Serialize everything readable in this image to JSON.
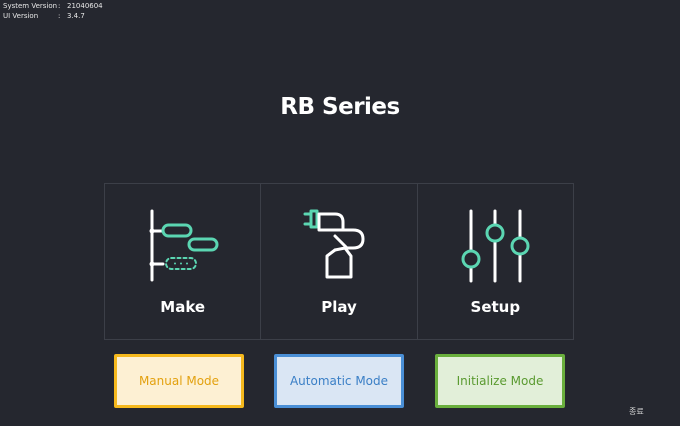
{
  "version_info": {
    "system_label": "System Version",
    "system_sep": ":",
    "system_value": "21040604",
    "ui_label": "UI Version",
    "ui_sep": ":",
    "ui_value": "3.4.7"
  },
  "title": "RB Series",
  "tiles": [
    {
      "label": "Make",
      "icon": "make-icon"
    },
    {
      "label": "Play",
      "icon": "robot-arm-icon"
    },
    {
      "label": "Setup",
      "icon": "sliders-icon"
    }
  ],
  "modes": {
    "manual": "Manual Mode",
    "automatic": "Automatic Mode",
    "initialize": "Initialize Mode"
  },
  "exit_label": "종료",
  "colors": {
    "background": "#25272f",
    "accent": "#5bd6b2",
    "manual": "#f6b91d",
    "automatic": "#4a8fd6",
    "initialize": "#6aaf3d"
  }
}
